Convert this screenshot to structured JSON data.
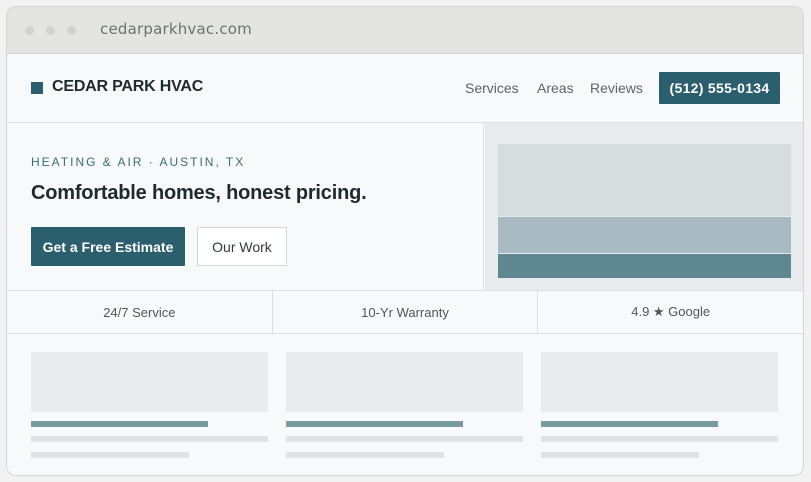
{
  "browser": {
    "url": "cedarparkhvac.com"
  },
  "header": {
    "logo_text": "CEDAR PARK HVAC",
    "nav": [
      "Services",
      "Areas",
      "Reviews"
    ],
    "phone": "(512) 555-0134"
  },
  "hero": {
    "eyebrow": "HEATING & AIR · AUSTIN, TX",
    "headline": "Comfortable homes, honest pricing.",
    "cta_primary": "Get a Free Estimate",
    "cta_secondary": "Our Work"
  },
  "trust": [
    "24/7 Service",
    "10-Yr Warranty",
    "4.9 ★ Google"
  ],
  "colors": {
    "brand": "#2c5f6e",
    "accent_muted": "#7a9aa2",
    "background": "#f7f9fb"
  }
}
